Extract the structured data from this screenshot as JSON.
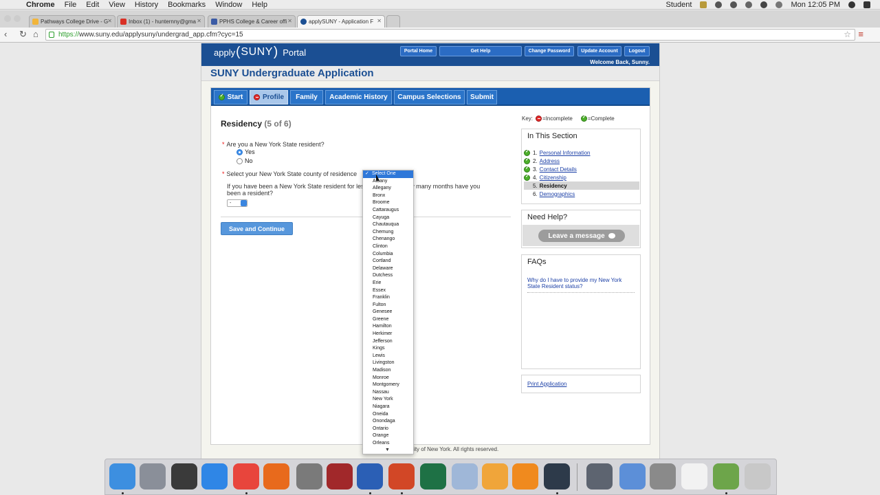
{
  "menubar": {
    "app": "Chrome",
    "items": [
      "File",
      "Edit",
      "View",
      "History",
      "Bookmarks",
      "Window",
      "Help"
    ],
    "user": "Student",
    "clock": "Mon 12:05 PM"
  },
  "browser": {
    "tabs": [
      {
        "title": "Pathways College Drive - G",
        "color": "#f2b53a"
      },
      {
        "title": "Inbox (1) - hunternny@gma",
        "color": "#d93025"
      },
      {
        "title": "PPHS College & Career offi",
        "color": "#3b5ba5"
      },
      {
        "title": "applySUNY - Application F",
        "color": "#1b4f93"
      }
    ],
    "url_scheme": "https://",
    "url_rest": "www.suny.edu/applysuny/undergrad_app.cfm?cyc=15"
  },
  "portal": {
    "logo_apply": "apply",
    "logo_suny": "SUNY",
    "logo_portal": "Portal",
    "nav": [
      "Portal Home",
      "Get Help",
      "Change Password",
      "Update Account",
      "Logout"
    ],
    "welcome": "Welcome Back, Sunny."
  },
  "app_title": "SUNY Undergraduate Application",
  "tabs": [
    "Start",
    "Profile",
    "Family",
    "Academic History",
    "Campus Selections",
    "Submit"
  ],
  "section": {
    "title": "Residency",
    "step": "(5 of 6)",
    "q1": "Are you a New York State resident?",
    "q1_options": [
      "Yes",
      "No"
    ],
    "q2": "Select your New York State county of residence",
    "q3": "If you have been a New York State resident for less than 1 year, how many months have you been a resident?",
    "months_value": "-",
    "save_button": "Save and Continue"
  },
  "key": {
    "label": "Key:",
    "incomplete": "=Incomplete",
    "complete": "=Complete"
  },
  "in_this_section": {
    "title": "In This Section",
    "items": [
      {
        "num": "1.",
        "label": "Personal Information"
      },
      {
        "num": "2.",
        "label": "Address"
      },
      {
        "num": "3.",
        "label": "Contact Details"
      },
      {
        "num": "4.",
        "label": "Citizenship"
      },
      {
        "num": "5.",
        "label": "Residency"
      },
      {
        "num": "6.",
        "label": "Demographics"
      }
    ]
  },
  "need_help": {
    "title": "Need Help?",
    "button": "Leave a message"
  },
  "faqs": {
    "title": "FAQs",
    "link": "Why do I have to provide my New York State Resident status?"
  },
  "print_link": "Print Application",
  "footer": "© 20… State University of New York. All rights reserved.",
  "county_dropdown": {
    "selected": "Select One",
    "options": [
      "Albany",
      "Allegany",
      "Bronx",
      "Broome",
      "Cattaraugus",
      "Cayuga",
      "Chautauqua",
      "Chemung",
      "Chenango",
      "Clinton",
      "Columbia",
      "Cortland",
      "Delaware",
      "Dutchess",
      "Erie",
      "Essex",
      "Franklin",
      "Fulton",
      "Genesee",
      "Greene",
      "Hamilton",
      "Herkimer",
      "Jefferson",
      "Kings",
      "Lewis",
      "Livingston",
      "Madison",
      "Monroe",
      "Montgomery",
      "Nassau",
      "New York",
      "Niagara",
      "Oneida",
      "Onondaga",
      "Ontario",
      "Orange",
      "Orleans"
    ]
  },
  "dock": {
    "apps": [
      {
        "name": "Finder",
        "color": "#3d8fe0"
      },
      {
        "name": "Launchpad",
        "color": "#8a8f99"
      },
      {
        "name": "Mission Control",
        "color": "#3a3a3a"
      },
      {
        "name": "Safari",
        "color": "#2f86e6"
      },
      {
        "name": "Chrome",
        "color": "#e8453c"
      },
      {
        "name": "Firefox",
        "color": "#e86a1c"
      },
      {
        "name": "Calculator",
        "color": "#7a7a7a"
      },
      {
        "name": "Dictionary",
        "color": "#a1282a"
      },
      {
        "name": "Word",
        "color": "#2b5fb5"
      },
      {
        "name": "PowerPoint",
        "color": "#d24726"
      },
      {
        "name": "Excel",
        "color": "#1e7145"
      },
      {
        "name": "Preview",
        "color": "#9fb7d8"
      },
      {
        "name": "Photos",
        "color": "#f0a53a"
      },
      {
        "name": "iBooks",
        "color": "#f08a1e"
      },
      {
        "name": "QuickTime",
        "color": "#2d3a4a"
      },
      {
        "name": "iWork",
        "color": "#5d6470"
      },
      {
        "name": "iLife",
        "color": "#5c8fd8"
      },
      {
        "name": "Folder Stack",
        "color": "#8a8a8a"
      },
      {
        "name": "Document",
        "color": "#f2f2f2"
      },
      {
        "name": "Downloads",
        "color": "#6da54a"
      },
      {
        "name": "Trash",
        "color": "#c8c8c8"
      }
    ]
  }
}
